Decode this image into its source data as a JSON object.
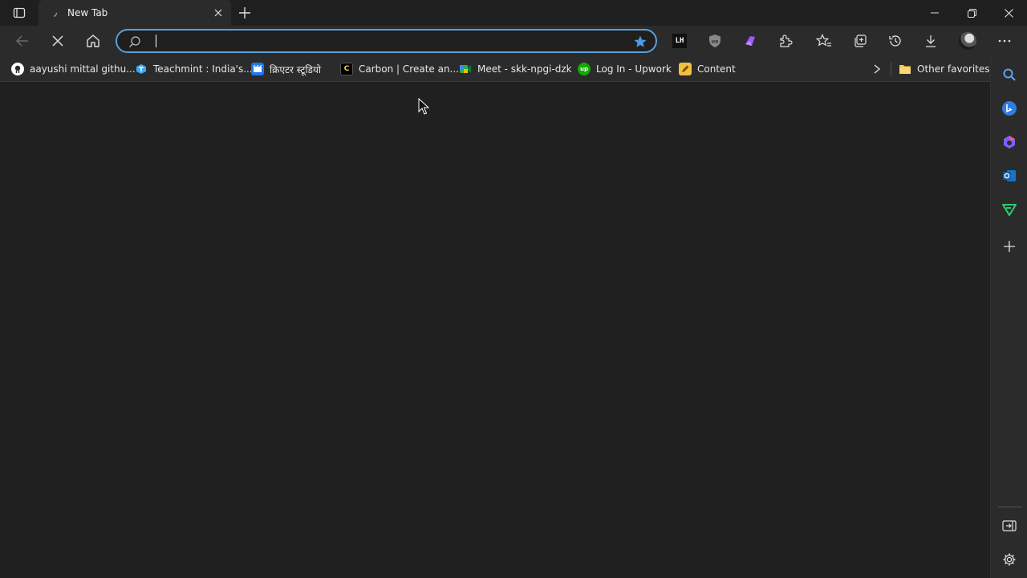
{
  "tab": {
    "title": "New Tab"
  },
  "address_bar": {
    "value": "",
    "placeholder": ""
  },
  "toolbar": {
    "extensions": [
      {
        "name": "lighthouse-extension-icon",
        "text": "LH"
      }
    ]
  },
  "bookmarks": [
    {
      "label": "aayushi mittal githu...",
      "icon": "github-icon"
    },
    {
      "label": "Teachmint : India's...",
      "icon": "teachmint-icon"
    },
    {
      "label": "क्रिएटर स्टूडियो",
      "icon": "creator-studio-icon"
    },
    {
      "label": "Carbon | Create an...",
      "icon": "carbon-icon"
    },
    {
      "label": "Meet - skk-npgi-dzk",
      "icon": "google-meet-icon"
    },
    {
      "label": "Log In - Upwork",
      "icon": "upwork-icon"
    },
    {
      "label": "Content",
      "icon": "content-icon"
    }
  ],
  "other_favorites": {
    "label": "Other favorites"
  },
  "colors": {
    "accent": "#5aa0d8",
    "background": "#202020",
    "chrome": "#2b2b2b"
  }
}
